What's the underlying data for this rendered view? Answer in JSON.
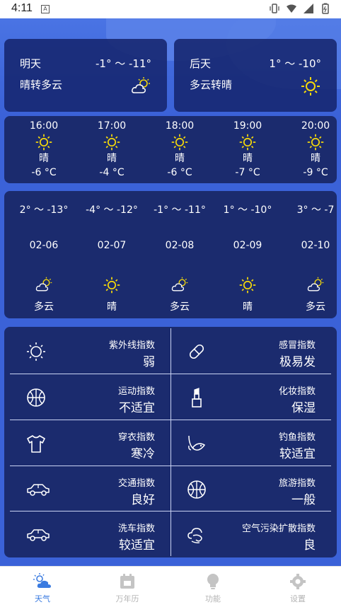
{
  "status_bar": {
    "time": "4:11",
    "notif_letter": "A"
  },
  "tomorrow": {
    "label": "明天",
    "range": "-1° ～ -11°",
    "condition": "晴转多云",
    "icon": "partly-cloudy-icon"
  },
  "day_after": {
    "label": "后天",
    "range": "1° ～ -10°",
    "condition": "多云转晴",
    "icon": "sun-icon"
  },
  "hourly": [
    {
      "time": "16:00",
      "cond": "晴",
      "temp": "-6 °C"
    },
    {
      "time": "17:00",
      "cond": "晴",
      "temp": "-4 °C"
    },
    {
      "time": "18:00",
      "cond": "晴",
      "temp": "-6 °C"
    },
    {
      "time": "19:00",
      "cond": "晴",
      "temp": "-7 °C"
    },
    {
      "time": "20:00",
      "cond": "晴",
      "temp": "-9 °C"
    }
  ],
  "daily": [
    {
      "range": "2° ～ -13°",
      "date": "02-06",
      "cond": "多云",
      "icon": "cloudy"
    },
    {
      "range": "-4° ～ -12°",
      "date": "02-07",
      "cond": "晴",
      "icon": "sun"
    },
    {
      "range": "-1° ～ -11°",
      "date": "02-08",
      "cond": "多云",
      "icon": "cloudy"
    },
    {
      "range": "1° ～ -10°",
      "date": "02-09",
      "cond": "晴",
      "icon": "sun"
    },
    {
      "range": "3° ～ -7",
      "date": "02-10",
      "cond": "多云",
      "icon": "cloudy"
    }
  ],
  "indices": [
    {
      "name": "紫外线指数",
      "value": "弱",
      "icon": "uv-icon"
    },
    {
      "name": "感冒指数",
      "value": "极易发",
      "icon": "pill-icon"
    },
    {
      "name": "运动指数",
      "value": "不适宜",
      "icon": "basketball-icon"
    },
    {
      "name": "化妆指数",
      "value": "保湿",
      "icon": "lipstick-icon"
    },
    {
      "name": "穿衣指数",
      "value": "寒冷",
      "icon": "tshirt-icon"
    },
    {
      "name": "钓鱼指数",
      "value": "较适宜",
      "icon": "fishing-icon"
    },
    {
      "name": "交通指数",
      "value": "良好",
      "icon": "car-icon"
    },
    {
      "name": "旅游指数",
      "value": "一般",
      "icon": "ball-icon"
    },
    {
      "name": "洗车指数",
      "value": "较适宜",
      "icon": "car-wash-icon"
    },
    {
      "name": "空气污染扩散指数",
      "value": "良",
      "icon": "wind-icon"
    }
  ],
  "bottom_nav": [
    {
      "label": "天气",
      "active": true
    },
    {
      "label": "万年历",
      "active": false
    },
    {
      "label": "功能",
      "active": false
    },
    {
      "label": "设置",
      "active": false
    }
  ],
  "colors": {
    "accent": "#3a7be0",
    "panel": "#1b2b6e",
    "background": "#3b62d8",
    "sun": "#f5d90a"
  }
}
